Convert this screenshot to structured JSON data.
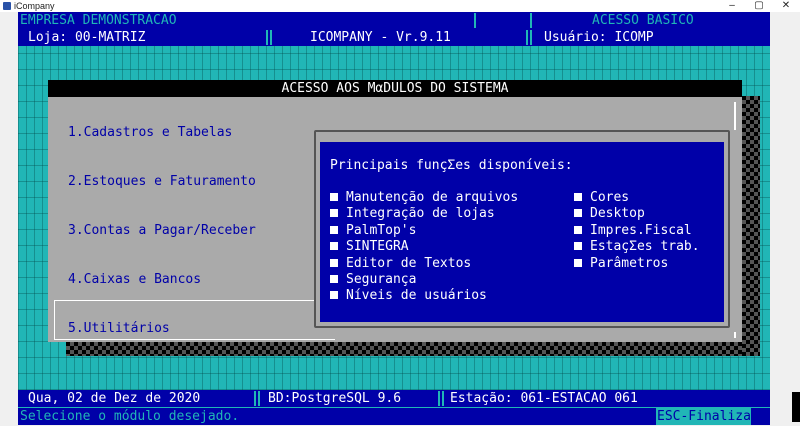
{
  "window": {
    "title": "iCompany",
    "minimize": "–",
    "maximize": "▢",
    "close": "✕"
  },
  "header": {
    "company": "EMPRESA DEMONSTRACAO",
    "access": "ACESSO BASICO",
    "store": "Loja: 00-MATRIZ",
    "version": "ICOMPANY - Vr.9.11",
    "user": "Usuário: ICOMP"
  },
  "modules_window": {
    "title": "ACESSO AOS MαDULOS DO SISTEMA",
    "items": [
      {
        "label": "1.Cadastros e Tabelas"
      },
      {
        "label": "2.Estoques e Faturamento"
      },
      {
        "label": "3.Contas a Pagar/Receber"
      },
      {
        "label": "4.Caixas e Bancos"
      },
      {
        "label": "5.Utilitários"
      }
    ],
    "selected_index": 4
  },
  "functions_panel": {
    "heading": "Principais funçΣes disponíveis:",
    "left_options": [
      "Manutenção de arquivos",
      "Integração de lojas",
      "PalmTop's",
      "SINTEGRA",
      "Editor de Textos",
      "Segurança",
      "Níveis de usuários"
    ],
    "right_options": [
      "Cores",
      "Desktop",
      "Impres.Fiscal",
      "EstaçΣes trab.",
      "Parâmetros"
    ]
  },
  "footer": {
    "date": "Qua, 02 de Dez de 2020",
    "database": "BD:PostgreSQL 9.6",
    "station": "Estação: 061-ESTACAO 061",
    "hint": "Selecione o módulo desejado.",
    "exit": "ESC-Finaliza"
  },
  "colors": {
    "background": "#21b6b6",
    "bar": "#0000a8",
    "panel": "#aaaaaa",
    "text_blue": "#0000a8"
  }
}
